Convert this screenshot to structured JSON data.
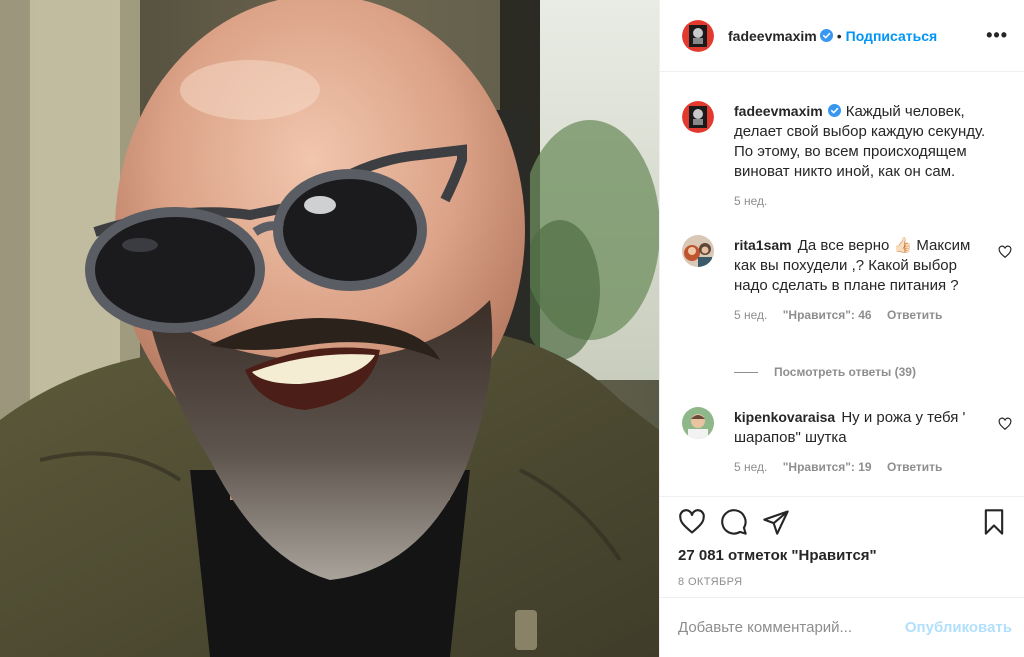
{
  "post": {
    "username": "fadeevmaxim",
    "follow_label": "Подписаться",
    "separator": "•",
    "more_label": "•••"
  },
  "caption": {
    "username": "fadeevmaxim",
    "text": "Каждый человек, делает свой выбор каждую секунду. По этому, во всем происходящем виноват никто иной, как он сам.",
    "time": "5 нед."
  },
  "comments": [
    {
      "username": "rita1sam",
      "text": "Да все верно 👍🏻 Максим как вы похудели ,? Какой выбор надо сделать в плане питания ?",
      "time": "5 нед.",
      "likes": "\"Нравится\": 46",
      "reply": "Ответить"
    },
    {
      "username": "kipenkovaraisa",
      "text": "Ну и рожа у тебя ' шарапов\" шутка",
      "time": "5 нед.",
      "likes": "\"Нравится\": 19",
      "reply": "Ответить"
    }
  ],
  "view_replies": "Посмотреть ответы (39)",
  "likes_count": "27 081 отметок \"Нравится\"",
  "date": "8 октября",
  "add_comment": {
    "placeholder": "Добавьте комментарий...",
    "publish_label": "Опубликовать"
  },
  "colors": {
    "accent": "#0095f6",
    "verified": "#3897f0",
    "muted": "#8e8e8e",
    "publish_disabled": "#b2dffc"
  }
}
